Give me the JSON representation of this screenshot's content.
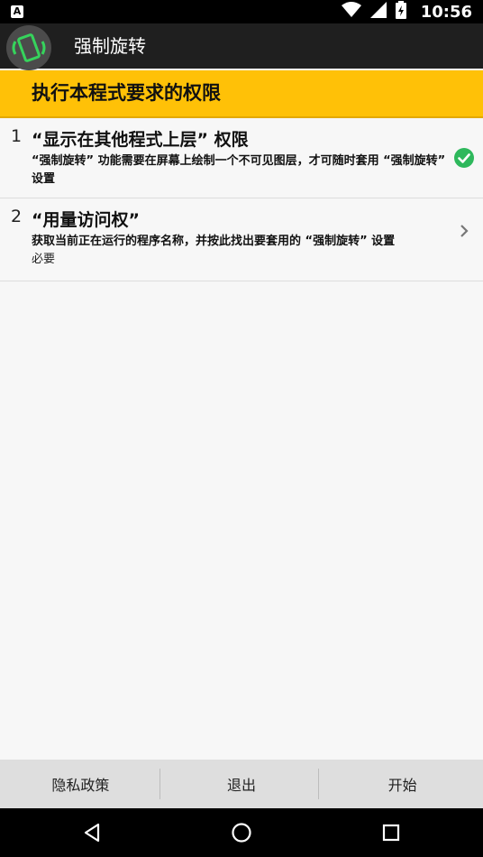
{
  "status_bar": {
    "app_badge": "A",
    "time": "10:56",
    "icons": [
      "wifi-icon",
      "signal-icon",
      "battery-icon"
    ]
  },
  "app_bar": {
    "title": "强制旋转",
    "icon": "rotate-screen-icon"
  },
  "banner": {
    "title": "执行本程式要求的权限"
  },
  "permissions": [
    {
      "number": "1",
      "title": "“显示在其他程式上层” 权限",
      "description": "“强制旋转” 功能需要在屏幕上绘制一个不可见图层，才可随时套用 “强制旋转” 设置",
      "note": "",
      "status_icon": "check-circle-icon",
      "granted": true
    },
    {
      "number": "2",
      "title": "“用量访问权”",
      "description": "获取当前正在运行的程序名称，并按此找出要套用的 “强制旋转” 设置",
      "note": "必要",
      "status_icon": "chevron-right-icon",
      "granted": false
    }
  ],
  "bottom_buttons": {
    "privacy": "隐私政策",
    "exit": "退出",
    "start": "开始"
  },
  "nav_bar": [
    "back-icon",
    "home-icon",
    "recents-icon"
  ],
  "colors": {
    "accent": "#ffc107",
    "check": "#2eb85c",
    "app_icon_green": "#36d35c",
    "app_bar": "#1f1f1f"
  }
}
